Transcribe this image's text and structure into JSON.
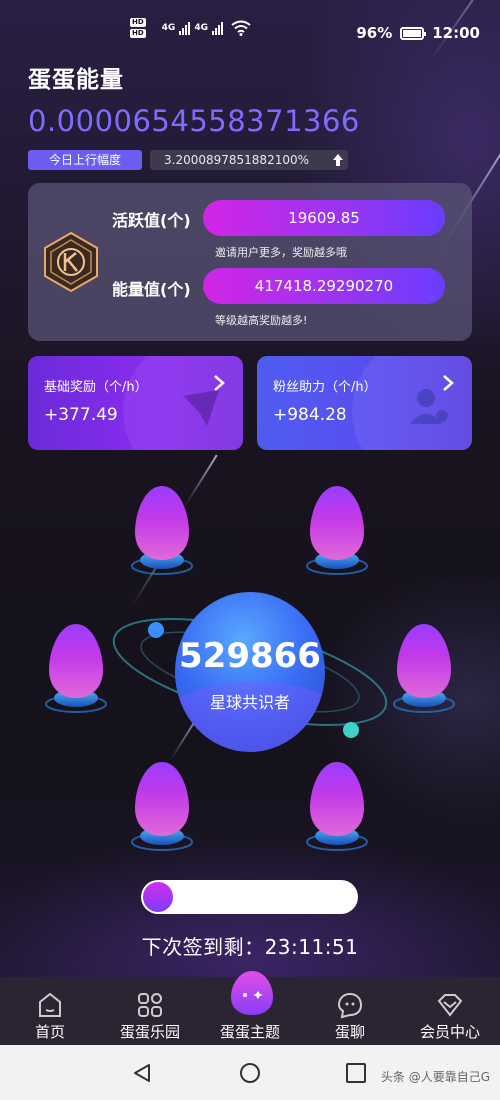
{
  "status_bar": {
    "hd1": "HD",
    "hd2": "HD",
    "net1": "4G",
    "net2": "4G",
    "battery": "96%",
    "time": "12:00"
  },
  "header": {
    "title": "蛋蛋能量",
    "energy_value": "0.0000654558371366",
    "today_label": "今日上行幅度",
    "today_value": "3.2000897851882100%"
  },
  "stats_panel": {
    "activity_label": "活跃值(个)",
    "activity_value": "19609.85",
    "activity_hint": "邀请用户更多，奖励越多哦",
    "energy_label": "能量值(个)",
    "energy_value": "417418.29290270",
    "energy_hint": "等级越高奖励越多!"
  },
  "cards": [
    {
      "title": "基础奖励（个/h）",
      "value": "+377.49"
    },
    {
      "title": "粉丝助力（个/h）",
      "value": "+984.28"
    }
  ],
  "planet": {
    "count": "529866",
    "label": "星球共识者"
  },
  "checkin": {
    "progress": 0.14,
    "countdown": "下次签到剩：23:11:51"
  },
  "tabs": [
    {
      "label": "首页",
      "icon": "home-icon"
    },
    {
      "label": "蛋蛋乐园",
      "icon": "grid-icon"
    },
    {
      "label": "蛋蛋主题",
      "icon": "egg-bubble-icon"
    },
    {
      "label": "蛋聊",
      "icon": "chat-icon"
    },
    {
      "label": "会员中心",
      "icon": "diamond-icon"
    }
  ],
  "watermark": "头条 @人要靠自己G",
  "colors": {
    "accent": "#7f6bff",
    "pill_start": "#d225e6",
    "pill_end": "#6a3dff",
    "tabbar": "#2b2533"
  }
}
